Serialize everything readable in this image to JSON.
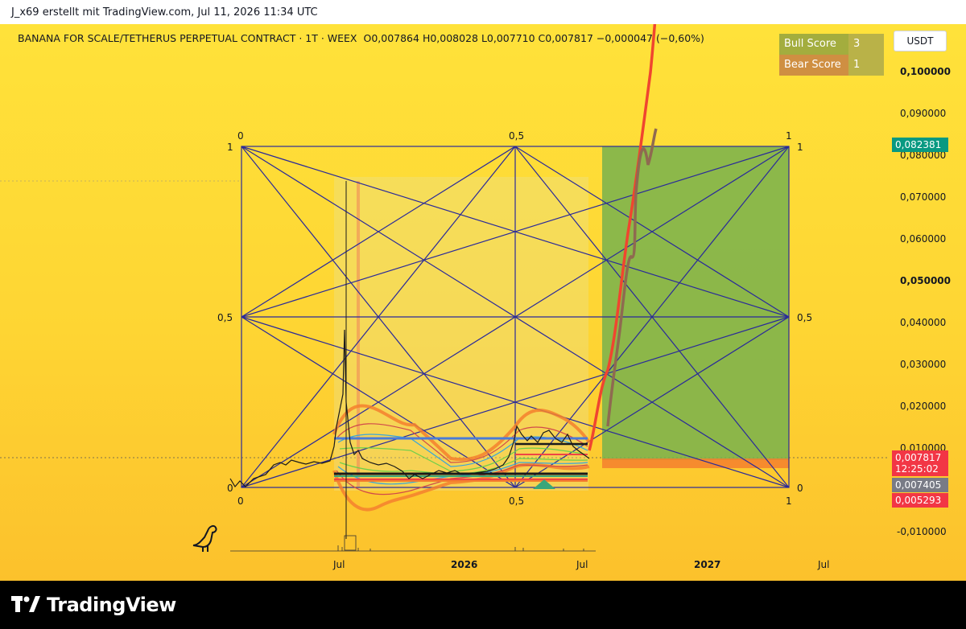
{
  "header": {
    "attribution": "J_x69 erstellt mit TradingView.com, Jul 11, 2026 11:34 UTC"
  },
  "legend": {
    "symbol": "BANANA FOR SCALE/TETHERUS PERPETUAL CONTRACT · 1T · WEEX",
    "ohlc": "O0,007864  H0,008028  L0,007710  C0,007817  −0,000047 (−0,60%)"
  },
  "scores": {
    "bull_label": "Bull Score",
    "bull_value": "3",
    "bear_label": "Bear Score",
    "bear_value": "1"
  },
  "currency_button": "USDT",
  "y_axis": {
    "labels": [
      "0,100000",
      "0,090000",
      "0,080000",
      "0,070000",
      "0,060000",
      "0,050000",
      "0,040000",
      "0,030000",
      "0,020000",
      "0,010000",
      "-0,010000"
    ],
    "tags": {
      "target": "0,082381",
      "last_price": "0,007817",
      "countdown": "12:25:02",
      "level_a": "0,007405",
      "level_b": "0,005293"
    }
  },
  "x_axis": {
    "labels": [
      "Jul",
      "2026",
      "Jul",
      "2027",
      "Jul"
    ]
  },
  "fib_labels": {
    "top": [
      "0",
      "0,5",
      "1"
    ],
    "left": [
      "1",
      "0,5",
      "0"
    ],
    "right": [
      "1",
      "0,5",
      "0"
    ],
    "bottom": [
      "0",
      "0,5",
      "1"
    ]
  },
  "footer": {
    "brand": "TradingView"
  },
  "colors": {
    "grid_lines": "#2a2a9a",
    "green_zone": "#78b14e",
    "orange_line": "#f4802e",
    "projection_red": "#f0452f",
    "projection_brown": "#8f6a50",
    "price_tag_red": "#f23645",
    "price_tag_green": "#089981"
  }
}
